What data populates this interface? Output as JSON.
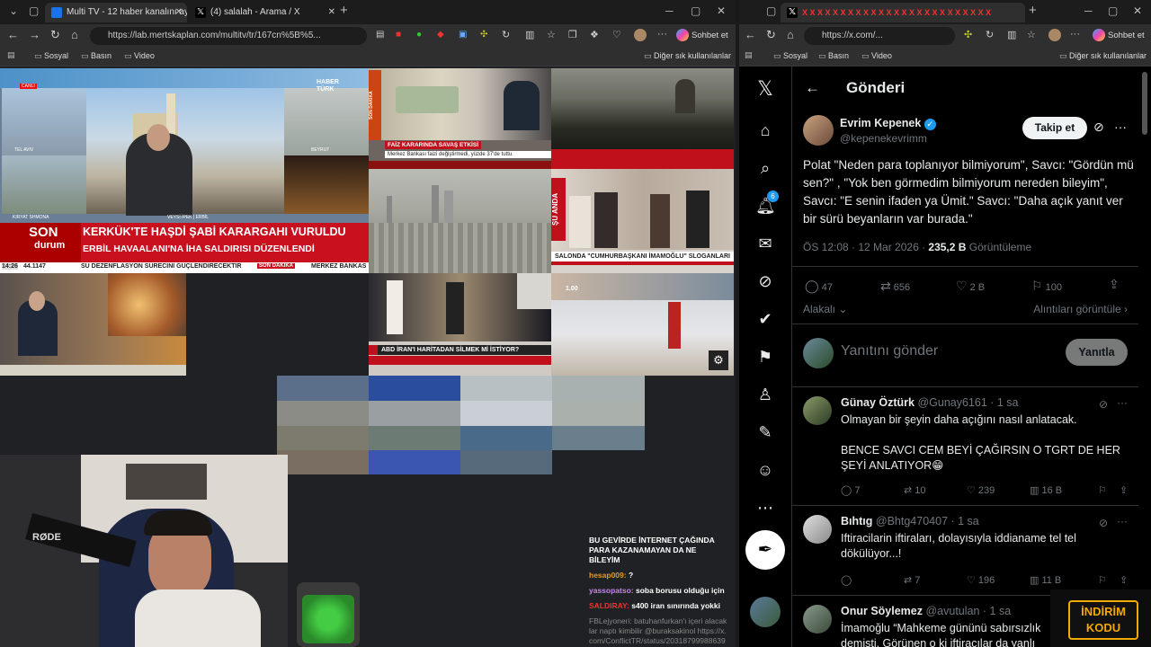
{
  "left_window": {
    "tabs": [
      {
        "label": "Multi TV - 12 haber kanalını aynı a..."
      },
      {
        "label": "(4) salalah - Arama / X"
      }
    ],
    "url": "https://lab.mertskaplan.com/multitv/tr/167cn%5B%5...",
    "copilot_label": "Sohbet et",
    "bookmarks": [
      "Sosyal",
      "Basın",
      "Video"
    ],
    "other_bookmarks": "Diğer sık kullanılanlar",
    "tv": {
      "haberturk_logo": "HABER TÜRK",
      "live_badge": "CANLI",
      "city1": "TEL AVIV",
      "city2": "BEYRUT",
      "city3": "KIRYAT SHMONA",
      "city4": "ERBİL",
      "reporter": "VEYSİ İPEK | ERBİL",
      "son_durum_1": "SON",
      "son_durum_2": "durum",
      "headline_1": "KERKÜK'TE HAŞDİ ŞABİ KARARGAHI VURULDU",
      "headline_2": "ERBİL HAVAALANI'NA İHA SALDIRISI DÜZENLENDİ",
      "ticker": "SU DEZENFLASYON SÜRECİNİ GÜÇLENDİRECEKTİR",
      "son_dakika": "SON DAKİKA",
      "merkez": "MERKEZ BANKAS",
      "time": "14:26",
      "index": "44.1147",
      "faiz_title": "FAİZ KARARINDA SAVAŞ ETKİSİ",
      "faiz_sub": "Merkez Bankası faizi değiştirmedi, yüzde 37'de tuttu",
      "su_anda": "ŞU ANDA",
      "salon_text": "SALONDA \"CUMHURBAŞKANI İMAMOĞLU\" SLOGANLARI",
      "abd_text": "ABD İRAN'I HARİTADAN SİLMEK Mİ İSTİYOR?",
      "time2": "1.00"
    },
    "chat": {
      "pinned": "BU GEVİRDE İNTERNET ÇAĞINDA PARA KAZANAMAYAN DA NE BİLEYİM",
      "messages": [
        {
          "user": "hesap009:",
          "text": "?"
        },
        {
          "user": "yassopatso:",
          "text": "soba borusu olduğu için"
        },
        {
          "user": "SALDIRAY:",
          "text": "s400 iran sınırında yokki"
        },
        {
          "user": "FBLejyoneri:",
          "text": "batuhanfurkan'ı içeri alacaklar naptı kimbilir @buraksakinol https://x.com/ConflictTR/status/2031879998863986"
        }
      ]
    }
  },
  "right_window": {
    "tab_label": "X X X X X X X X X X X X X X X X X X X X X X X X X",
    "url": "https://x.com/...",
    "copilot_label": "Sohbet et",
    "bookmarks": [
      "Sosyal",
      "Basın",
      "Video"
    ],
    "other_bookmarks": "Diğer sık kullanılanlar",
    "header_title": "Gönderi",
    "notification_count": "6",
    "post": {
      "author": "Evrim Kepenek",
      "handle": "@kepenekevrimm",
      "follow_label": "Takip et",
      "text": "Polat \"Neden para toplanıyor bilmiyorum\",  Savcı: \"Gördün mü sen?\" ,  \"Yok ben görmedim bilmiyorum nereden bileyim\",  Savcı: \"E senin ifaden ya Ümit.\" Savcı: \"Daha açık yanıt ver bir sürü beyanların var burada.\"",
      "time": "ÖS 12:08 · 12 Mar 2026 · ",
      "views_count": "235,2 B",
      "views_label": " Görüntüleme",
      "replies": "47",
      "reposts": "656",
      "likes": "2 B",
      "bookmarks": "100",
      "relevant_label": "Alakalı",
      "quotes_label": "Alıntıları görüntüle",
      "reply_placeholder": "Yanıtını gönder",
      "reply_button": "Yanıtla"
    },
    "replies": [
      {
        "name": "Günay Öztürk",
        "handle": "@Gunay6161 · 1 sa",
        "text": "Olmayan bir şeyin daha açığını nasıl anlatacak.",
        "text2": "BENCE SAVCI CEM BEYİ ÇAĞIRSIN O TGRT DE HER ŞEYİ ANLATIYOR😁",
        "replies": "7",
        "reposts": "10",
        "likes": "239",
        "views": "16 B"
      },
      {
        "name": "Bıhtıg",
        "handle": "@Bhtg470407 · 1 sa",
        "text": "Iftiracilarin iftiraları, dolayısıyla iddianame tel tel dökülüyor...!",
        "replies": "",
        "reposts": "7",
        "likes": "196",
        "views": "11 B"
      },
      {
        "name": "Onur Söylemez",
        "handle": "@avutulan · 1 sa",
        "text": "İmamoğlu “Mahkeme gününü sabırsızlık",
        "text2": "demişti. Görünen o ki iftiracılar da yanlı"
      }
    ],
    "promo": {
      "line1": "İNDİRİM",
      "line2": "KODU"
    }
  }
}
